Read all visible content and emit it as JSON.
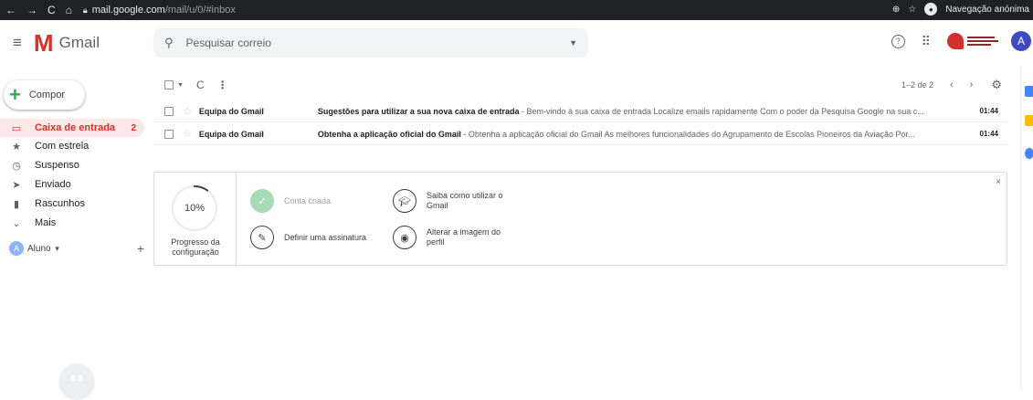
{
  "browser": {
    "url_host": "mail.google.com",
    "url_path": "/mail/u/0/#inbox",
    "incognito_label": "Navegação anónima",
    "nav_icons": [
      "back-icon",
      "forward-icon",
      "reload-icon",
      "home-icon"
    ]
  },
  "header": {
    "app_name": "Gmail",
    "search_placeholder": "Pesquisar correio",
    "help_icon": "?",
    "avatar_letter": "A"
  },
  "sidebar": {
    "compose_label": "Compor",
    "items": [
      {
        "label": "Caixa de entrada",
        "icon": "inbox-icon",
        "count": "2",
        "active": true
      },
      {
        "label": "Com estrela",
        "icon": "star-icon"
      },
      {
        "label": "Suspenso",
        "icon": "clock-icon"
      },
      {
        "label": "Enviado",
        "icon": "send-icon"
      },
      {
        "label": "Rascunhos",
        "icon": "draft-icon"
      },
      {
        "label": "Mais",
        "icon": "chevron-down-icon"
      }
    ],
    "user": {
      "name": "Aluno",
      "avatar_letter": "A"
    }
  },
  "toolbar": {
    "pagination": "1–2 de 2"
  },
  "emails": [
    {
      "sender": "Equipa do Gmail",
      "subject": "Sugestões para utilizar a sua nova caixa de entrada",
      "snippet": " - Bem-vindo à sua caixa de entrada Localize emails rapidamente Com o poder da Pesquisa Google na sua c...",
      "time": "01:44"
    },
    {
      "sender": "Equipa do Gmail",
      "subject": "Obtenha a aplicação oficial do Gmail",
      "snippet": " - Obtenha a aplicação oficial do Gmail As melhores funcionalidades do Agrupamento de Escolas Pioneiros da Aviação Por...",
      "time": "01:44"
    }
  ],
  "setup": {
    "progress_pct": "10%",
    "progress_value": 0.1,
    "progress_label_1": "Progresso da",
    "progress_label_2": "configuração",
    "tasks": [
      {
        "label": "Conta criada",
        "done": true,
        "icon": "check-icon"
      },
      {
        "label_1": "Saiba como utilizar o",
        "label_2": "Gmail",
        "icon": "graduation-cap-icon"
      },
      {
        "label": "Definir uma assinatura",
        "icon": "pencil-icon"
      },
      {
        "label_1": "Alterar a imagem do",
        "label_2": "perfil",
        "icon": "account-icon"
      }
    ],
    "close": "×"
  },
  "colors": {
    "brand_red": "#d93025",
    "compose_plus": "#34a853",
    "active_bg": "#fce8e6",
    "done_green": "#a8dab5"
  }
}
